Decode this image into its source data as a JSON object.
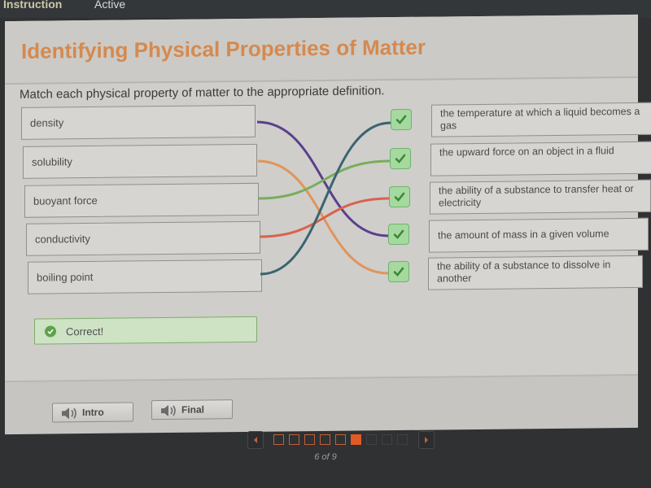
{
  "topbar": {
    "tabs": [
      {
        "label": "Instruction"
      },
      {
        "label": "Active"
      }
    ]
  },
  "activity": {
    "title": "Identifying Physical Properties of Matter",
    "prompt": "Match each physical property of matter to the appropriate definition.",
    "terms": [
      {
        "label": "density",
        "line_color": "#5b3f8c"
      },
      {
        "label": "solubility",
        "line_color": "#e0955a"
      },
      {
        "label": "buoyant force",
        "line_color": "#79ad5c"
      },
      {
        "label": "conductivity",
        "line_color": "#d9634d"
      },
      {
        "label": "boiling point",
        "line_color": "#3a6470"
      }
    ],
    "definitions": [
      {
        "label": "the temperature at which a liquid becomes a gas",
        "status": "correct"
      },
      {
        "label": "the upward force on an object in a fluid",
        "status": "correct"
      },
      {
        "label": "the ability of a substance to transfer heat or electricity",
        "status": "correct"
      },
      {
        "label": "the amount of mass in a given volume",
        "status": "correct"
      },
      {
        "label": "the ability of a substance to dissolve in another",
        "status": "correct"
      }
    ],
    "matches": [
      {
        "term": 0,
        "definition": 3
      },
      {
        "term": 1,
        "definition": 4
      },
      {
        "term": 2,
        "definition": 1
      },
      {
        "term": 3,
        "definition": 2
      },
      {
        "term": 4,
        "definition": 0
      }
    ],
    "feedback": {
      "text": "Correct!",
      "icon": "check-circle-icon"
    }
  },
  "footer": {
    "intro_label": "Intro",
    "final_label": "Final"
  },
  "pager": {
    "current": 6,
    "total": 9,
    "label": "6 of 9",
    "accent_color": "#e05a25"
  }
}
